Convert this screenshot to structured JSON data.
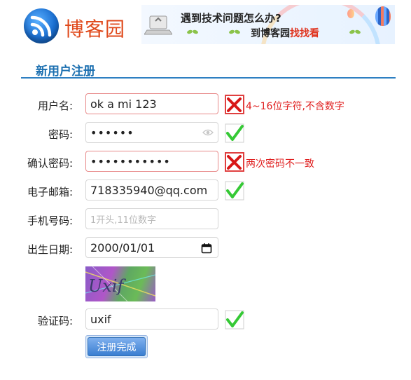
{
  "header": {
    "site_name": "博客园",
    "banner_line1": "遇到技术问题怎么办?",
    "banner_line2_prefix": "到博客园",
    "banner_line2_highlight": "找找看"
  },
  "form": {
    "title": "新用户注册",
    "fields": [
      {
        "label": "用户名:",
        "value": "ok a mi 123",
        "status": "error",
        "message": "4~16位字符,不含数字"
      },
      {
        "label": "密码:",
        "value": "••••••",
        "status": "ok",
        "icon": "eye-icon"
      },
      {
        "label": "确认密码:",
        "value": "•••••••••••",
        "status": "error",
        "message": "两次密码不一致"
      },
      {
        "label": "电子邮箱:",
        "value": "718335940@qq.com",
        "status": "ok"
      },
      {
        "label": "手机号码:",
        "placeholder": "1开头,11位数字"
      },
      {
        "label": "出生日期:",
        "value": "2000/01/01",
        "icon": "calendar-icon"
      },
      {
        "label": "验证码:",
        "value": "uxif",
        "status": "ok"
      }
    ],
    "captcha_text": "Uxif",
    "submit_label": "注册完成"
  },
  "colors": {
    "accent": "#1b6fb0",
    "error": "#e02020",
    "ok": "#33cc33"
  }
}
